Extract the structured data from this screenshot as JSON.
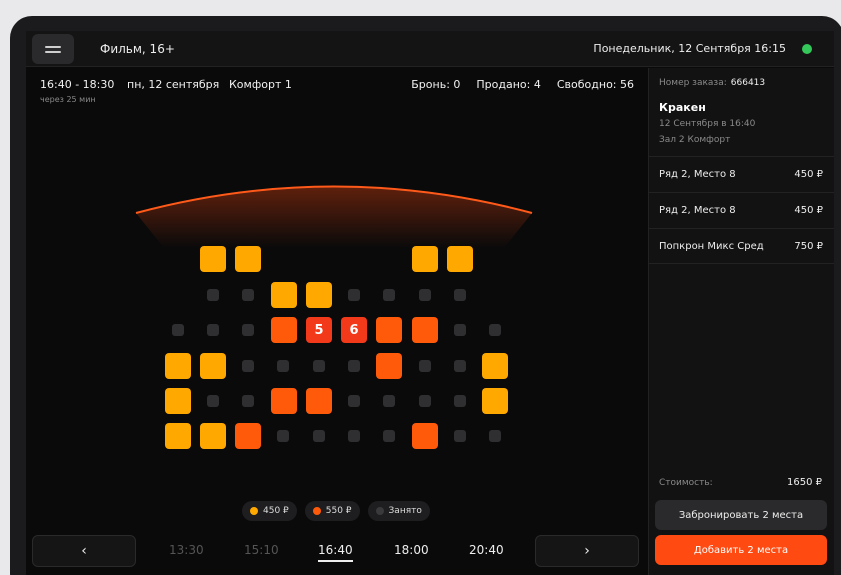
{
  "header": {
    "title": "Фильм, 16+",
    "datetime": "Понедельник, 12 Сентября  16:15",
    "status_color": "#34c759"
  },
  "session": {
    "time": "16:40 - 18:30",
    "starts_in": "через 25 мин",
    "date": "пн, 12 сентября",
    "hall": "Комфорт 1",
    "booked": "Бронь: 0",
    "sold": "Продано: 4",
    "free": "Свободно: 56"
  },
  "seats": {
    "colors": {
      "price_450": "#ffa800",
      "price_550": "#ff5a0a",
      "selected": "#f23a1a",
      "occupied": "#2f2f31"
    },
    "selected_labels": [
      "5",
      "6"
    ]
  },
  "legend": {
    "price_450": "450 ₽",
    "price_550": "550 ₽",
    "occupied": "Занято"
  },
  "times": {
    "prev": "‹",
    "next": "›",
    "slots": [
      "13:30",
      "15:10",
      "16:40",
      "18:00",
      "20:40"
    ],
    "active": "16:40"
  },
  "order": {
    "number_label": "Номер заказа:",
    "number": "666413",
    "film": "Кракен",
    "film_date": "12 Сентября в 16:40",
    "film_hall": "Зал 2 Комфорт",
    "items": [
      {
        "name": "Ряд 2, Место 8",
        "price": "450 ₽"
      },
      {
        "name": "Ряд 2, Место 8",
        "price": "450 ₽"
      },
      {
        "name": "Попкрон Микс Сред",
        "price": "750 ₽"
      }
    ],
    "cost_label": "Стоимость:",
    "cost": "1650 ₽",
    "book_label": "Забронировать 2 места",
    "add_label": "Добавить 2 места",
    "accent": "#ff4a12"
  }
}
